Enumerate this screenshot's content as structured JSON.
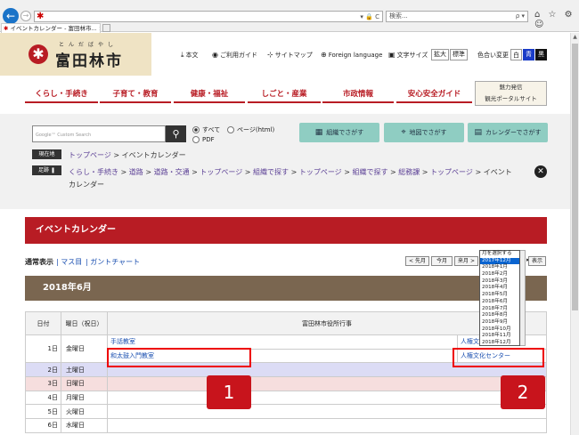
{
  "browser": {
    "tab_title": "イベントカレンダー - 富田林市...",
    "tab_close": "×",
    "search_placeholder": "検索...",
    "back": "←",
    "forward": "→",
    "address_controls": "▾ 🔒 C",
    "search_controls": "ρ ▾",
    "window_icons": "⌂ ☆ ⚙ ☺"
  },
  "header": {
    "logo_ruby": "とんだばやし",
    "logo_text": "富田林市",
    "links": [
      "本文",
      "ご利用ガイド",
      "サイトマップ",
      "Foreign language"
    ],
    "text_size_label": "文字サイズ",
    "text_size_buttons": [
      "拡大",
      "標準"
    ],
    "color_label": "色合い変更",
    "color_buttons": [
      "白",
      "青",
      "黒"
    ]
  },
  "nav": {
    "items": [
      "くらし・手続き",
      "子育て・教育",
      "健康・福祉",
      "しごと・産業",
      "市政情報",
      "安心安全ガイド"
    ],
    "banner_line1": "魅力発信",
    "banner_line2": "観光ポータルサイト"
  },
  "search": {
    "placeholder": "Google™ Custom Search",
    "radio_all": "すべて",
    "radio_page": "ページ(html)",
    "radio_pdf": "PDF",
    "buttons": [
      "組織でさがす",
      "地図でさがす",
      "カレンダーでさがす"
    ]
  },
  "breadcrumb": {
    "current_label": "現在地",
    "current": [
      "トップページ",
      "イベントカレンダー"
    ],
    "history_label": "足跡",
    "history": [
      "くらし・手続き",
      "道路",
      "道路・交通",
      "トップページ",
      "組織で探す",
      "トップページ",
      "組織で探す",
      "総務課",
      "トップページ",
      "イベント"
    ],
    "history_tail": "カレンダー"
  },
  "calendar": {
    "title": "イベントカレンダー",
    "views": [
      "通常表示",
      "マス目",
      "ガントチャート"
    ],
    "nav_buttons": [
      "< 先月",
      "今月",
      "来月 >"
    ],
    "show_button": "表示",
    "month_options": [
      "月を選択する",
      "2017年12月",
      "2018年1月",
      "2018年2月",
      "2018年3月",
      "2018年4月",
      "2018年5月",
      "2018年6月",
      "2018年7月",
      "2018年8月",
      "2018年9月",
      "2018年10月",
      "2018年11月",
      "2018年12月"
    ],
    "month_selected": "2017年12月",
    "month_heading": "2018年6月",
    "col_date": "日付",
    "col_weekday": "曜日（祝日）",
    "col_events": "富田林市役所行事",
    "rows": [
      {
        "date": "1日",
        "weekday": "金曜日",
        "event1": "手話教室",
        "event2": "人権文化センター",
        "event3": "和太鼓入門教室",
        "event4": "人権文化センター"
      },
      {
        "date": "2日",
        "weekday": "土曜日"
      },
      {
        "date": "3日",
        "weekday": "日曜日"
      },
      {
        "date": "4日",
        "weekday": "月曜日"
      },
      {
        "date": "5日",
        "weekday": "火曜日"
      },
      {
        "date": "6日",
        "weekday": "水曜日"
      }
    ]
  },
  "annotations": {
    "badge1": "1",
    "badge2": "2"
  },
  "colors": {
    "brand_red": "#b81c24",
    "teal": "#8fcdc2",
    "highlight": "#e00000"
  }
}
